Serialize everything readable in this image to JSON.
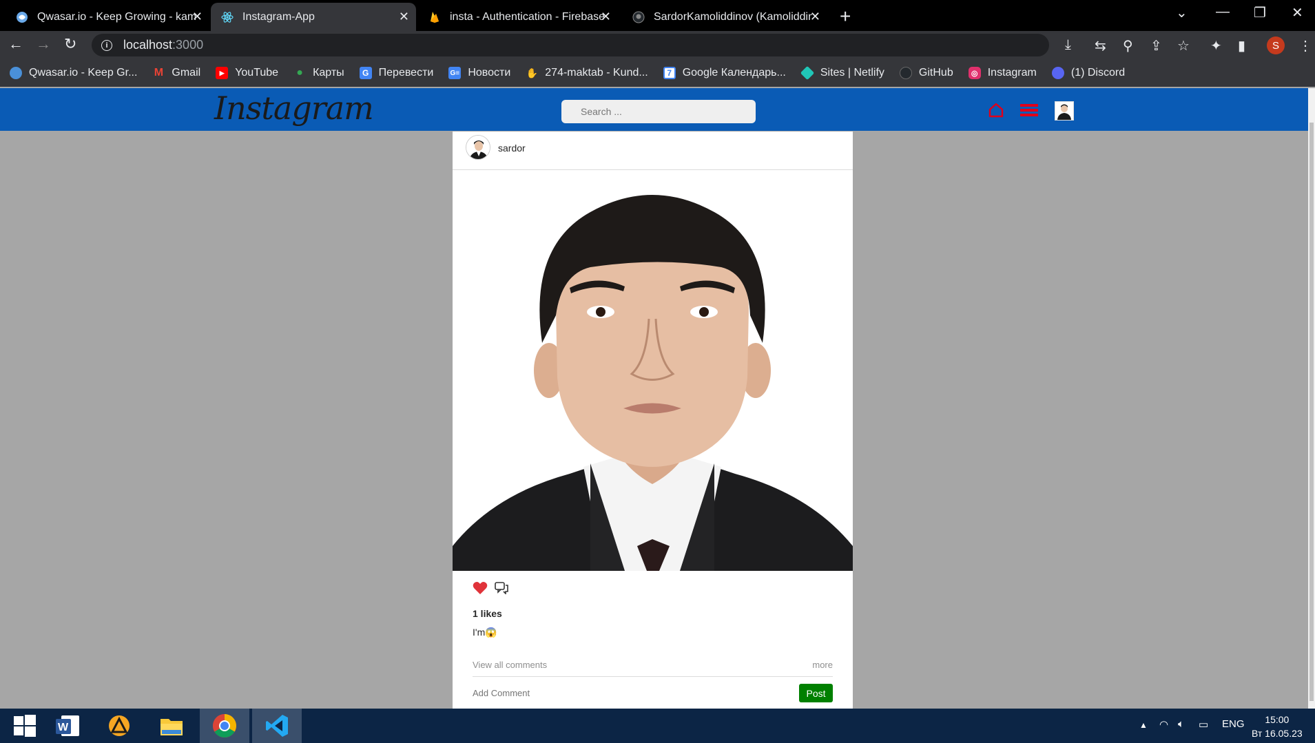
{
  "browser": {
    "tabs": [
      {
        "title": "Qwasar.io - Keep Growing - kam",
        "icon": "qwasar-icon",
        "active": false
      },
      {
        "title": "Instagram-App",
        "icon": "react-icon",
        "active": true
      },
      {
        "title": "insta - Authentication - Firebase",
        "icon": "firebase-icon",
        "active": false
      },
      {
        "title": "SardorKamoliddinov (Kamoliddin",
        "icon": "github-icon",
        "active": false
      }
    ],
    "close_glyph": "✕",
    "new_tab_glyph": "+",
    "url_host": "localhost",
    "url_port": ":3000",
    "profile_initial": "S",
    "bookmarks": [
      {
        "label": "Qwasar.io - Keep Gr...",
        "icon": "qwasar-icon",
        "color": "#4a90d9"
      },
      {
        "label": "Gmail",
        "icon": "gmail-icon",
        "color": "#ea4335"
      },
      {
        "label": "YouTube",
        "icon": "youtube-icon",
        "color": "#ff0000"
      },
      {
        "label": "Карты",
        "icon": "maps-icon",
        "color": "#34a853"
      },
      {
        "label": "Перевести",
        "icon": "translate-icon",
        "color": "#4285f4"
      },
      {
        "label": "Новости",
        "icon": "news-icon",
        "color": "#4285f4"
      },
      {
        "label": "274-maktab - Kund...",
        "icon": "hand-icon",
        "color": "#9c6ade"
      },
      {
        "label": "Google Календарь...",
        "icon": "calendar-icon",
        "color": "#4285f4"
      },
      {
        "label": "Sites | Netlify",
        "icon": "netlify-icon",
        "color": "#20c6b7"
      },
      {
        "label": "GitHub",
        "icon": "github-icon",
        "color": "#24292e"
      },
      {
        "label": "Instagram",
        "icon": "instagram-icon",
        "color": "#e1306c"
      },
      {
        "label": "(1) Discord",
        "icon": "discord-icon",
        "color": "#5865f2"
      }
    ]
  },
  "app": {
    "logo_text": "Instagram",
    "search_placeholder": "Search ...",
    "accent_color": "#0a5bb5",
    "icon_color": "#e0001a"
  },
  "post": {
    "username": "sardor",
    "likes": "1 likes",
    "caption": "I'm😱",
    "view_all": "View all comments",
    "more": "more",
    "add_comment_placeholder": "Add Comment",
    "post_button": "Post"
  },
  "taskbar": {
    "apps": [
      "windows-start-icon",
      "word-icon",
      "aimp-icon",
      "file-explorer-icon",
      "chrome-icon",
      "vscode-icon"
    ],
    "language": "ENG",
    "time": "15:00",
    "date": "Вт 16.05.23"
  }
}
